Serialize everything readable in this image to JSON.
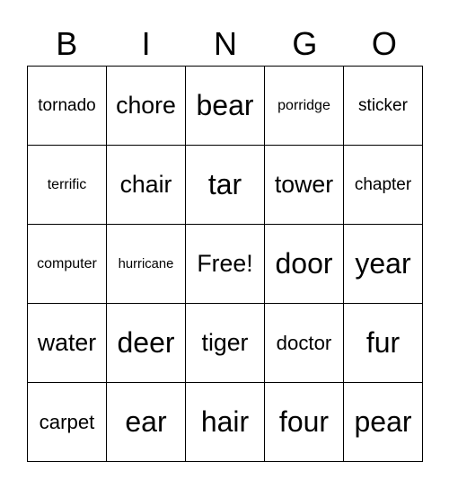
{
  "header": [
    "B",
    "I",
    "N",
    "G",
    "O"
  ],
  "cells": [
    [
      "tornado",
      "chore",
      "bear",
      "porridge",
      "sticker"
    ],
    [
      "terrific",
      "chair",
      "tar",
      "tower",
      "chapter"
    ],
    [
      "computer",
      "hurricane",
      "Free!",
      "door",
      "year"
    ],
    [
      "water",
      "deer",
      "tiger",
      "doctor",
      "fur"
    ],
    [
      "carpet",
      "ear",
      "hair",
      "four",
      "pear"
    ]
  ]
}
